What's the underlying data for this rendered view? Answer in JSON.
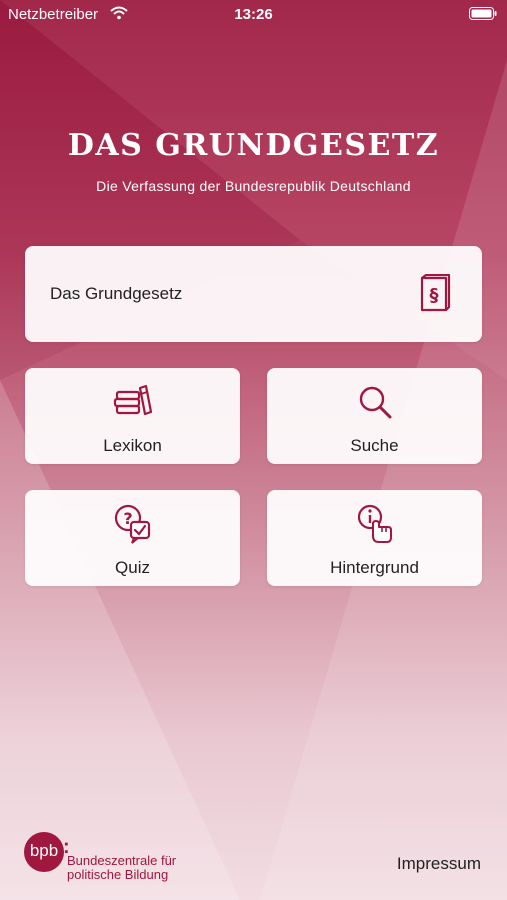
{
  "status_bar": {
    "carrier": "Netzbetreiber",
    "time": "13:26"
  },
  "header": {
    "title": "DAS GRUNDGESETZ",
    "subtitle": "Die Verfassung der Bundesrepublik Deutschland"
  },
  "menu": {
    "grundgesetz": {
      "label": "Das Grundgesetz",
      "icon": "law-book-icon"
    },
    "lexikon": {
      "label": "Lexikon",
      "icon": "books-icon"
    },
    "suche": {
      "label": "Suche",
      "icon": "search-icon"
    },
    "quiz": {
      "label": "Quiz",
      "icon": "question-check-icon"
    },
    "hintergrund": {
      "label": "Hintergrund",
      "icon": "info-hand-icon"
    }
  },
  "footer": {
    "logo_mark": "bpb",
    "logo_line1": "Bundeszentrale für",
    "logo_line2": "politische Bildung",
    "impressum": "Impressum"
  },
  "colors": {
    "brand": "#a0173f",
    "header_top": "#9e1d42",
    "card_bg": "#ffffff"
  }
}
